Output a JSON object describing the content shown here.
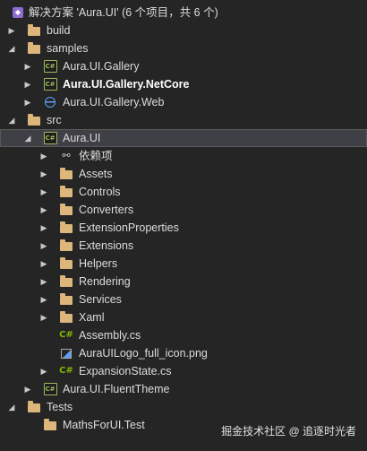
{
  "solution": {
    "label": "解决方案 'Aura.UI' (6 个项目，共 6 个)"
  },
  "tree": [
    {
      "label": "build",
      "icon": "folder-icon",
      "arrow": "▶"
    },
    {
      "label": "samples",
      "icon": "folder-icon",
      "arrow": "◢"
    },
    {
      "label": "Aura.UI.Gallery",
      "icon": "csharp-project-icon",
      "arrow": "▶"
    },
    {
      "label": "Aura.UI.Gallery.NetCore",
      "icon": "csharp-project-icon",
      "arrow": "▶"
    },
    {
      "label": "Aura.UI.Gallery.Web",
      "icon": "web-project-icon",
      "arrow": "▶"
    },
    {
      "label": "src",
      "icon": "folder-icon",
      "arrow": "◢"
    },
    {
      "label": "Aura.UI",
      "icon": "csharp-project-icon",
      "arrow": "◢"
    },
    {
      "label": "依赖项",
      "icon": "dependencies-icon",
      "arrow": "▶"
    },
    {
      "label": "Assets",
      "icon": "folder-icon",
      "arrow": "▶"
    },
    {
      "label": "Controls",
      "icon": "folder-icon",
      "arrow": "▶"
    },
    {
      "label": "Converters",
      "icon": "folder-icon",
      "arrow": "▶"
    },
    {
      "label": "ExtensionProperties",
      "icon": "folder-icon",
      "arrow": "▶"
    },
    {
      "label": "Extensions",
      "icon": "folder-icon",
      "arrow": "▶"
    },
    {
      "label": "Helpers",
      "icon": "folder-icon",
      "arrow": "▶"
    },
    {
      "label": "Rendering",
      "icon": "folder-icon",
      "arrow": "▶"
    },
    {
      "label": "Services",
      "icon": "folder-icon",
      "arrow": "▶"
    },
    {
      "label": "Xaml",
      "icon": "folder-icon",
      "arrow": "▶"
    },
    {
      "label": "Assembly.cs",
      "icon": "csharp-file-icon",
      "arrow": ""
    },
    {
      "label": "AuraUILogo_full_icon.png",
      "icon": "image-file-icon",
      "arrow": ""
    },
    {
      "label": "ExpansionState.cs",
      "icon": "csharp-file-icon",
      "arrow": "▶"
    },
    {
      "label": "Aura.UI.FluentTheme",
      "icon": "csharp-project-icon",
      "arrow": "▶"
    },
    {
      "label": "Tests",
      "icon": "folder-icon",
      "arrow": "◢"
    },
    {
      "label": "MathsForUI.Test",
      "icon": "folder-icon",
      "arrow": ""
    }
  ],
  "watermark": "掘金技术社区 @ 追逐时光者",
  "colors": {
    "background": "#252526",
    "selection": "#3f3f46",
    "folder": "#dcb67a",
    "csharp": "#9bbb59"
  }
}
